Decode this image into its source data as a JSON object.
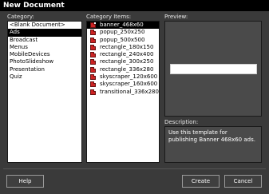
{
  "window": {
    "title": "New Document"
  },
  "category": {
    "label": "Category:",
    "items": [
      "<Blank Document>",
      "Ads",
      "Broadcast",
      "Menus",
      "MobileDevices",
      "PhotoSlideshow",
      "Presentation",
      "Quiz"
    ],
    "selected": "Ads"
  },
  "category_items": {
    "label": "Category Items:",
    "items": [
      "banner_468x60",
      "popup_250x250",
      "popup_500x500",
      "rectangle_180x150",
      "rectangle_240x400",
      "rectangle_300x250",
      "rectangle_336x280",
      "skyscraper_120x600",
      "skyscraper_160x600",
      "transitional_336x280"
    ],
    "selected": "banner_468x60",
    "icon": "flash-document-icon"
  },
  "preview": {
    "label": "Preview:"
  },
  "description": {
    "label": "Description:",
    "text": "Use this template for publishing Banner 468x60 ads."
  },
  "buttons": {
    "help": "Help",
    "create": "Create",
    "cancel": "Cancel"
  },
  "colors": {
    "selection": "#000000",
    "dialog_bg": "#3a3a3a",
    "list_bg": "#ffffff"
  }
}
